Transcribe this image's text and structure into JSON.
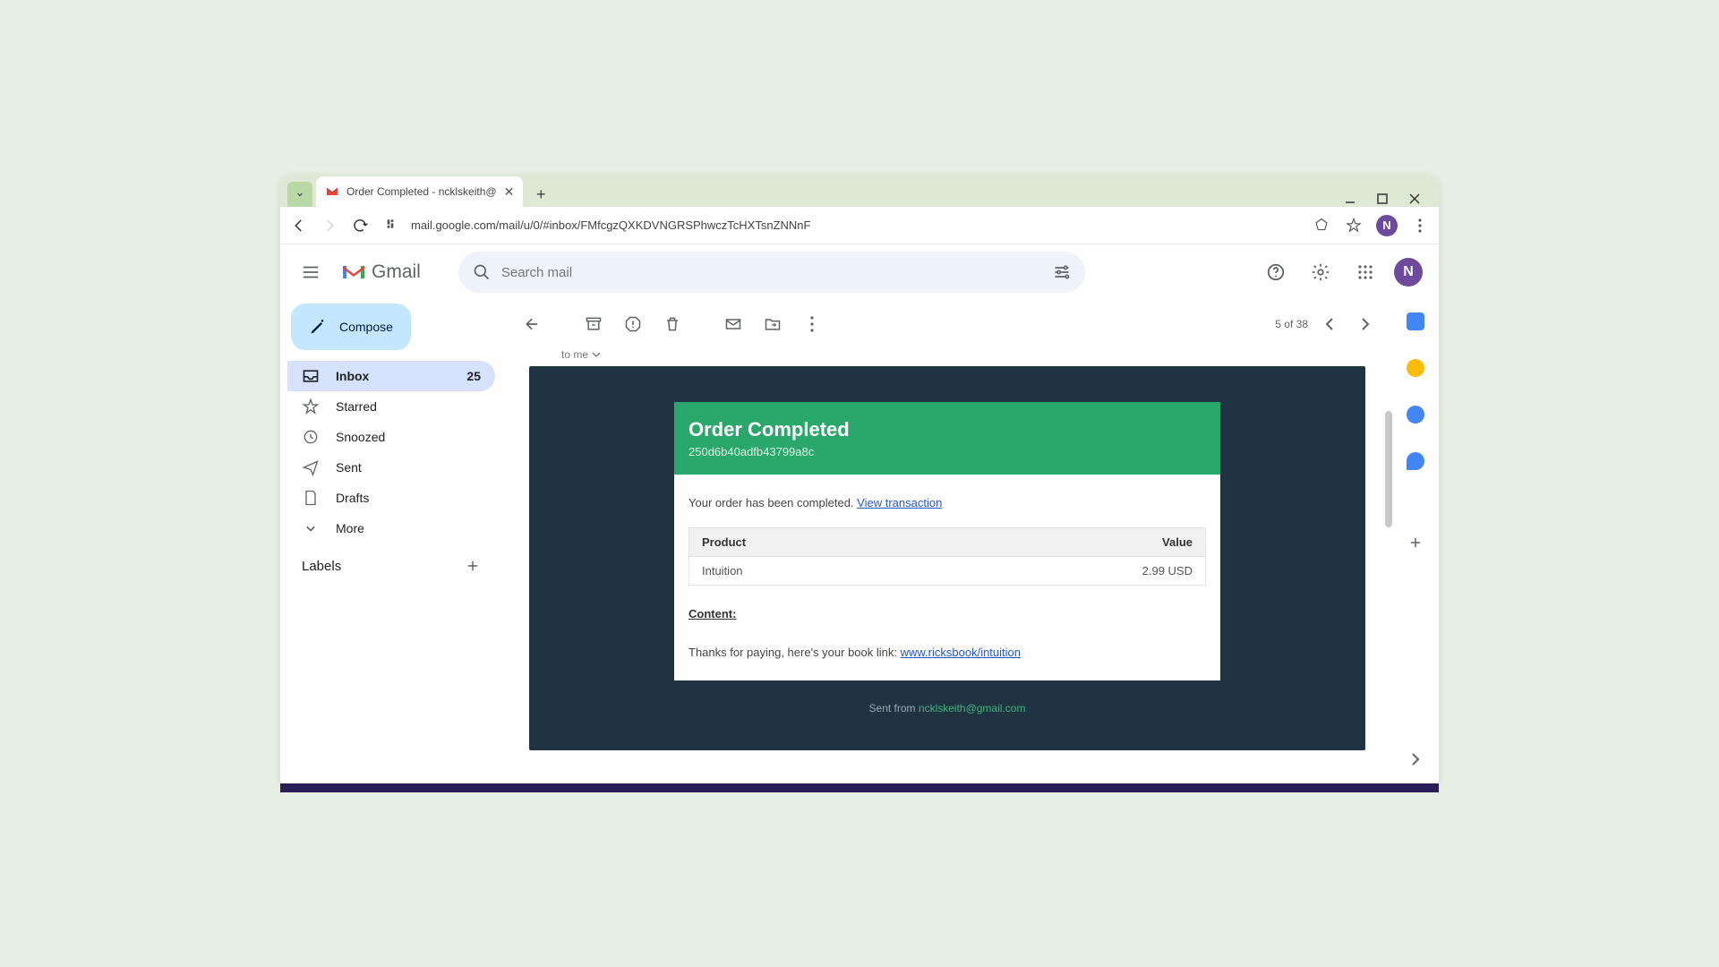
{
  "browser": {
    "tab_title": "Order Completed - ncklskeith@",
    "url": "mail.google.com/mail/u/0/#inbox/FMfcgzQXKDVNGRSPhwczTcHXTsnZNNnF",
    "profile_initial": "N"
  },
  "header": {
    "logo_text": "Gmail",
    "search_placeholder": "Search mail",
    "avatar_initial": "N"
  },
  "sidebar": {
    "compose": "Compose",
    "items": [
      {
        "label": "Inbox",
        "count": "25"
      },
      {
        "label": "Starred"
      },
      {
        "label": "Snoozed"
      },
      {
        "label": "Sent"
      },
      {
        "label": "Drafts"
      },
      {
        "label": "More"
      }
    ],
    "labels_title": "Labels"
  },
  "toolbar": {
    "pager_text": "5 of 38"
  },
  "email": {
    "to_line": "to me",
    "card": {
      "title": "Order Completed",
      "order_id": "250d6b40adfb43799a8c",
      "completed_text": "Your order has been completed. ",
      "view_link": "View transaction",
      "table": {
        "col_product": "Product",
        "col_value": "Value",
        "row_product": "Intuition",
        "row_value": "2.99 USD"
      },
      "content_label": "Content:",
      "thanks_prefix": "Thanks for paying, here's your book link: ",
      "book_link": "www.ricksbook/intuition",
      "sent_from_prefix": "Sent from ",
      "sent_from_email": "ncklskeith@gmail.com"
    }
  }
}
